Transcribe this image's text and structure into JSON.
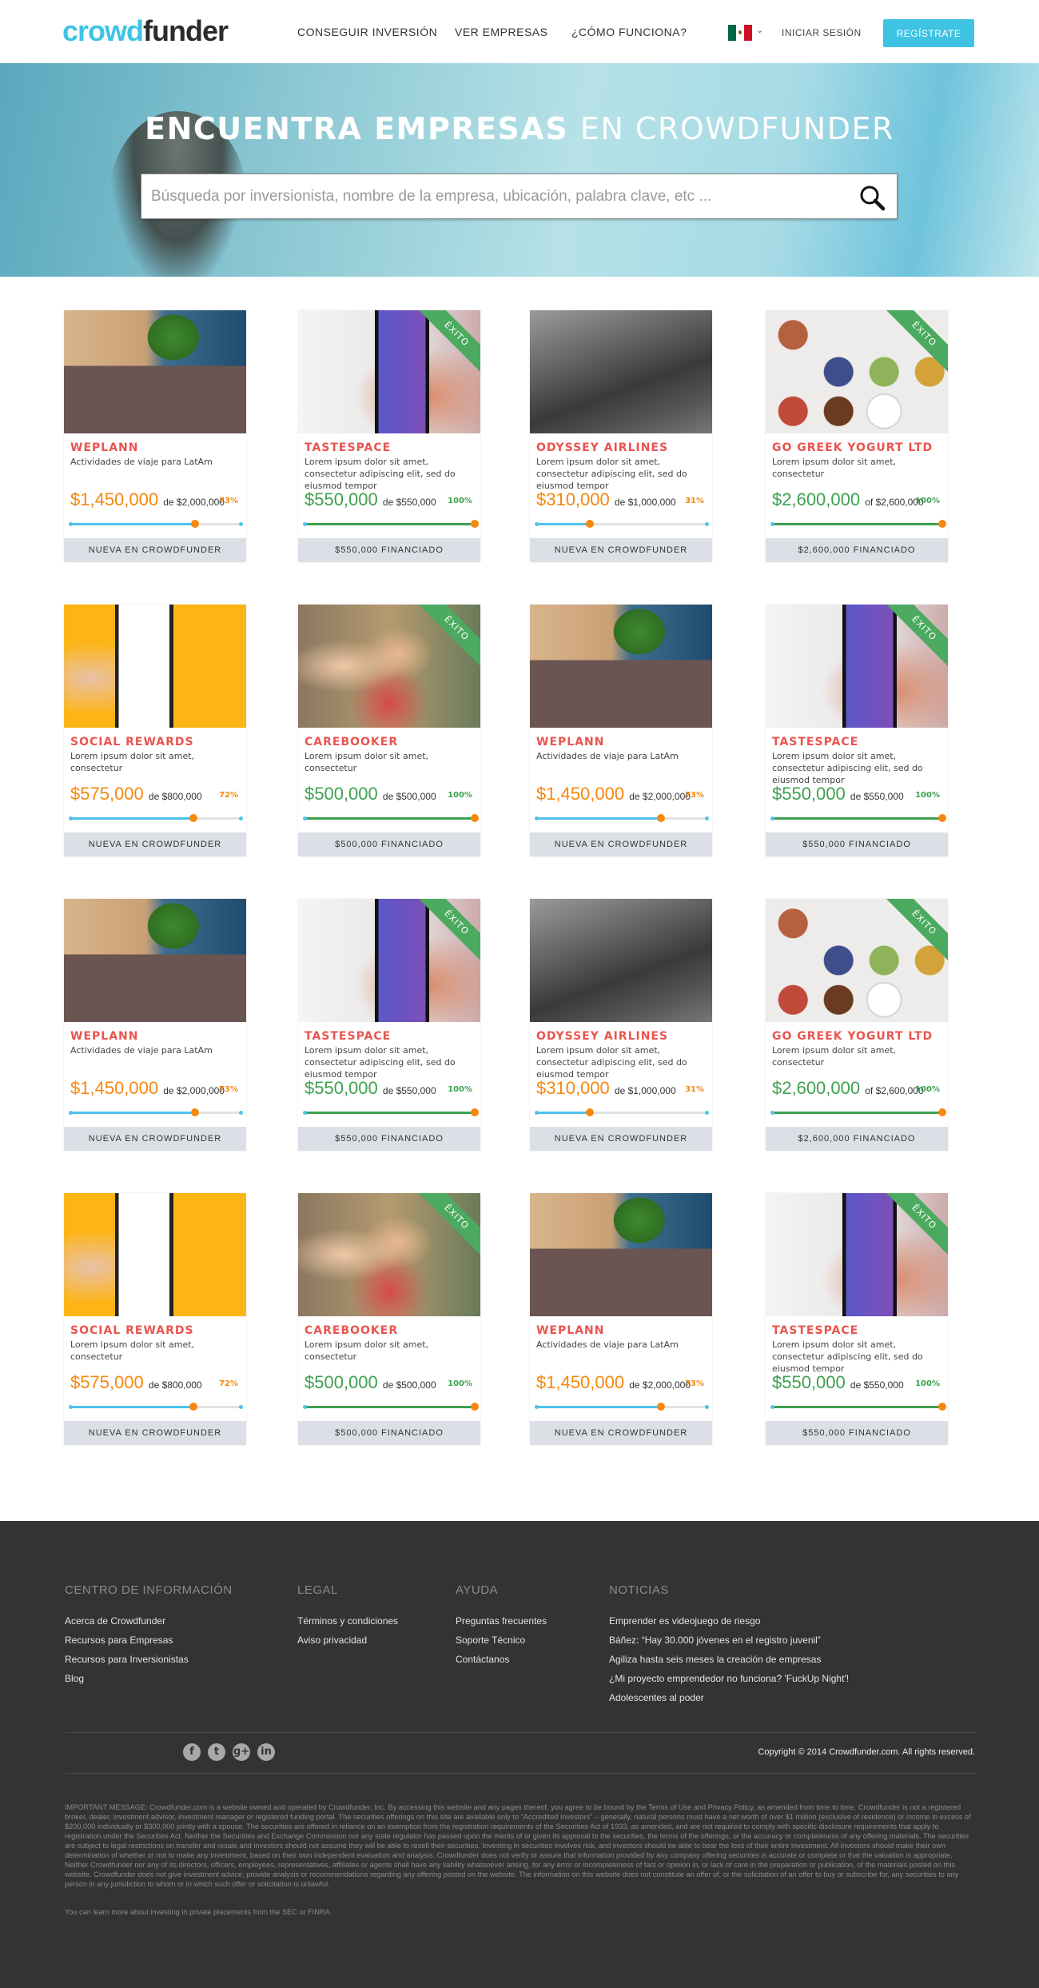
{
  "header": {
    "logo_a": "crowd",
    "logo_b": "funder",
    "nav": [
      "CONSEGUIR INVERSIÓN",
      "VER EMPRESAS",
      "¿CÓMO FUNCIONA?"
    ],
    "language": "mexico-flag-icon",
    "login": "INICIAR SESIÓN",
    "register": "REGÍSTRATE"
  },
  "hero": {
    "title_bold": "ENCUENTRA EMPRESAS",
    "title_light": "EN CROWDFUNDER",
    "search_placeholder": "Búsqueda por inversionista, nombre de la empresa, ubicación, palabra clave, etc ..."
  },
  "colors": {
    "accent": "#3ec3e3",
    "title": "#e9544f",
    "orange": "#f7870d",
    "green": "#3ea14f",
    "ribbon": "#4caa60"
  },
  "ribbon_label": "ÉXITO",
  "cards": [
    {
      "name": "WEPLANN",
      "desc": "Actividades de viaje para LatAm",
      "raised": "$1,450,000",
      "of": "de $2,000,000",
      "pct": "73%",
      "progress": 73,
      "funded": false,
      "footer": "NUEVA EN CROWDFUNDER",
      "img": "weplann"
    },
    {
      "name": "TASTESPACE",
      "desc": "Lorem ipsum dolor sit amet, consectetur adipiscing elit, sed do eiusmod tempor",
      "raised": "$550,000",
      "of": "de $550,000",
      "pct": "100%",
      "progress": 100,
      "funded": true,
      "footer": "$550,000 FINANCIADO",
      "img": "phone"
    },
    {
      "name": "ODYSSEY AIRLINES",
      "desc": "Lorem ipsum dolor sit amet, consectetur adipiscing elit, sed do eiusmod tempor",
      "raised": "$310,000",
      "of": "de $1,000,000",
      "pct": "31%",
      "progress": 31,
      "funded": false,
      "footer": "NUEVA EN CROWDFUNDER",
      "img": "plane"
    },
    {
      "name": "GO GREEK YOGURT LTD",
      "desc": "Lorem ipsum dolor sit amet, consectetur",
      "raised": "$2,600,000",
      "of": "of $2,600,000",
      "pct": "100%",
      "progress": 100,
      "funded": true,
      "footer": "$2,600,000 FINANCIADO",
      "img": "yogurt"
    },
    {
      "name": "SOCIAL REWARDS",
      "desc": "Lorem ipsum dolor sit amet, consectetur",
      "raised": "$575,000",
      "of": "de $800,000",
      "pct": "72%",
      "progress": 72,
      "funded": false,
      "footer": "NUEVA EN CROWDFUNDER",
      "img": "social"
    },
    {
      "name": "CAREBOOKER",
      "desc": "Lorem ipsum dolor sit amet, consectetur",
      "raised": "$500,000",
      "of": "de $500,000",
      "pct": "100%",
      "progress": 100,
      "funded": true,
      "footer": "$500,000 FINANCIADO",
      "img": "family"
    },
    {
      "name": "WEPLANN",
      "desc": "Actividades de viaje para LatAm",
      "raised": "$1,450,000",
      "of": "de $2,000,000",
      "pct": "73%",
      "progress": 73,
      "funded": false,
      "footer": "NUEVA EN CROWDFUNDER",
      "img": "weplann"
    },
    {
      "name": "TASTESPACE",
      "desc": "Lorem ipsum dolor sit amet, consectetur adipiscing elit, sed do eiusmod tempor",
      "raised": "$550,000",
      "of": "de $550,000",
      "pct": "100%",
      "progress": 100,
      "funded": true,
      "footer": "$550,000 FINANCIADO",
      "img": "phone"
    },
    {
      "name": "WEPLANN",
      "desc": "Actividades de viaje para LatAm",
      "raised": "$1,450,000",
      "of": "de $2,000,000",
      "pct": "73%",
      "progress": 73,
      "funded": false,
      "footer": "NUEVA EN CROWDFUNDER",
      "img": "weplann"
    },
    {
      "name": "TASTESPACE",
      "desc": "Lorem ipsum dolor sit amet, consectetur adipiscing elit, sed do eiusmod tempor",
      "raised": "$550,000",
      "of": "de $550,000",
      "pct": "100%",
      "progress": 100,
      "funded": true,
      "footer": "$550,000 FINANCIADO",
      "img": "phone"
    },
    {
      "name": "ODYSSEY AIRLINES",
      "desc": "Lorem ipsum dolor sit amet, consectetur adipiscing elit, sed do eiusmod tempor",
      "raised": "$310,000",
      "of": "de $1,000,000",
      "pct": "31%",
      "progress": 31,
      "funded": false,
      "footer": "NUEVA EN CROWDFUNDER",
      "img": "plane"
    },
    {
      "name": "GO GREEK YOGURT LTD",
      "desc": "Lorem ipsum dolor sit amet, consectetur",
      "raised": "$2,600,000",
      "of": "of $2,600,000",
      "pct": "100%",
      "progress": 100,
      "funded": true,
      "footer": "$2,600,000 FINANCIADO",
      "img": "yogurt"
    },
    {
      "name": "SOCIAL REWARDS",
      "desc": "Lorem ipsum dolor sit amet, consectetur",
      "raised": "$575,000",
      "of": "de $800,000",
      "pct": "72%",
      "progress": 72,
      "funded": false,
      "footer": "NUEVA EN CROWDFUNDER",
      "img": "social"
    },
    {
      "name": "CAREBOOKER",
      "desc": "Lorem ipsum dolor sit amet, consectetur",
      "raised": "$500,000",
      "of": "de $500,000",
      "pct": "100%",
      "progress": 100,
      "funded": true,
      "footer": "$500,000 FINANCIADO",
      "img": "family"
    },
    {
      "name": "WEPLANN",
      "desc": "Actividades de viaje para LatAm",
      "raised": "$1,450,000",
      "of": "de $2,000,000",
      "pct": "73%",
      "progress": 73,
      "funded": false,
      "footer": "NUEVA EN CROWDFUNDER",
      "img": "weplann"
    },
    {
      "name": "TASTESPACE",
      "desc": "Lorem ipsum dolor sit amet, consectetur adipiscing elit, sed do eiusmod tempor",
      "raised": "$550,000",
      "of": "de $550,000",
      "pct": "100%",
      "progress": 100,
      "funded": true,
      "footer": "$550,000 FINANCIADO",
      "img": "phone"
    }
  ],
  "footer": {
    "columns": [
      {
        "heading": "CENTRO DE INFORMACIÓN",
        "links": [
          "Acerca de Crowdfunder",
          "Recursos para Empresas",
          "Recursos para Inversionistas",
          "Blog"
        ]
      },
      {
        "heading": "LEGAL",
        "links": [
          "Términos y condiciones",
          "Aviso privacidad"
        ]
      },
      {
        "heading": "AYUDA",
        "links": [
          "Preguntas frecuentes",
          "Soporte Técnico",
          "Contáctanos"
        ]
      },
      {
        "heading": "NOTICIAS",
        "links": [
          "Emprender es videojuego de riesgo",
          "Báñez: “Hay 30.000 jóvenes en el registro juvenil”",
          "Agiliza hasta seis meses la creación de empresas",
          "¿Mi proyecto emprendedor no funciona? 'FuckUp Night'!",
          "Adolescentes al poder"
        ]
      }
    ],
    "social": [
      {
        "icon": "facebook-icon",
        "glyph": "f"
      },
      {
        "icon": "twitter-icon",
        "glyph": "t"
      },
      {
        "icon": "google-plus-icon",
        "glyph": "g+"
      },
      {
        "icon": "linkedin-icon",
        "glyph": "in"
      }
    ],
    "copyright": "Copyright © 2014 Crowdfunder.com. All rights reserved.",
    "legal": "IMPORTANT MESSAGE: Crowdfunder.com is a website owned and operated by Crowdfunder, Inc. By accessing this website and any pages thereof, you agree to be bound by the Terms of Use and Privacy Policy, as amended from time to time. Crowdfunder is not a registered broker, dealer, investment advisor, investment manager or registered funding portal. The securities offerings on this site are available only to \"Accredited Investors\" – generally, natural persons must have a net worth of over $1 million (exclusive of residence) or income in excess of $200,000 individually or $300,000 jointly with a spouse. The securities are offered in reliance on an exemption from the registration requirements of the Securities Act of 1933, as amended, and are not required to comply with specific disclosure requirements that apply to registration under the Securities Act. Neither the Securities and Exchange Commission nor any state regulator has passed upon the merits of or given its approval to the securities, the terms of the offerings, or the accuracy or completeness of any offering materials. The securities are subject to legal restrictions on transfer and resale and investors should not assume they will be able to resell their securities. Investing in securities involves risk, and investors should be able to bear the loss of their entire investment. All investors should make their own determination of whether or not to make any investment, based on their own independent evaluation and analysis. Crowdfunder does not verify or assure that information provided by any company offering securities is accurate or complete or that the valuation is appropriate. Neither Crowdfunder nor any of its directors, officers, employees, representatives, affiliates or agents shall have any liability whatsoever arising, for any error or incompleteness of fact or opinion in, or lack of care in the preparation or publication, of the materials posted on this website. Crowdfunder does not give investment advice, provide analysis or recommendations regarding any offering posted on the website. The information on this website does not constitute an offer of, or the solicitation of an offer to buy or subscribe for, any securities to any person in any jurisdiction to whom or in which such offer or solicitation is unlawful.",
    "legal_more": "You can learn more about investing in private placements from the SEC or FINRA."
  }
}
